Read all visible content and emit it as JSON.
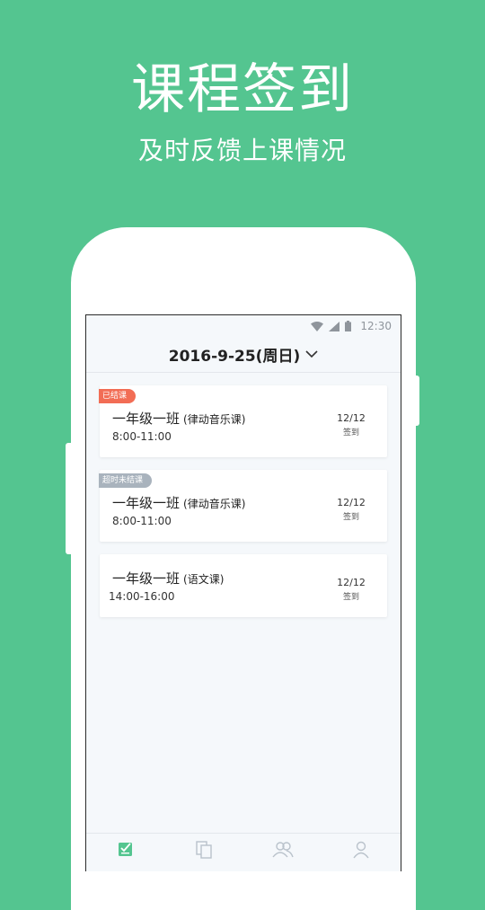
{
  "hero": {
    "title": "课程签到",
    "subtitle": "及时反馈上课情况"
  },
  "status_bar": {
    "time": "12:30",
    "icons": [
      "wifi-icon",
      "signal-icon",
      "battery-icon"
    ]
  },
  "header": {
    "date": "2016-9-25(周日)",
    "dropdown_icon": "chevron-down-icon"
  },
  "courses": [
    {
      "badge": "已结课",
      "name": "一年级一班",
      "type": "(律动音乐课)",
      "time": "8:00-11:00",
      "count": "12/12",
      "sign_label": "签到"
    },
    {
      "badge": "超时未结课",
      "name": "一年级一班",
      "type": "(律动音乐课)",
      "time": "8:00-11:00",
      "count": "12/12",
      "sign_label": "签到"
    },
    {
      "badge": "",
      "name": "一年级一班",
      "type": "(语文课)",
      "time": "14:00-16:00",
      "count": "12/12",
      "sign_label": "签到"
    }
  ],
  "tabbar": {
    "icons": [
      "sign-in-icon",
      "documents-icon",
      "group-icon",
      "profile-icon"
    ]
  },
  "colors": {
    "background": "#54c590",
    "accent": "#54c590",
    "badge_done": "#f26d55",
    "badge_over": "#a9b3bd"
  }
}
